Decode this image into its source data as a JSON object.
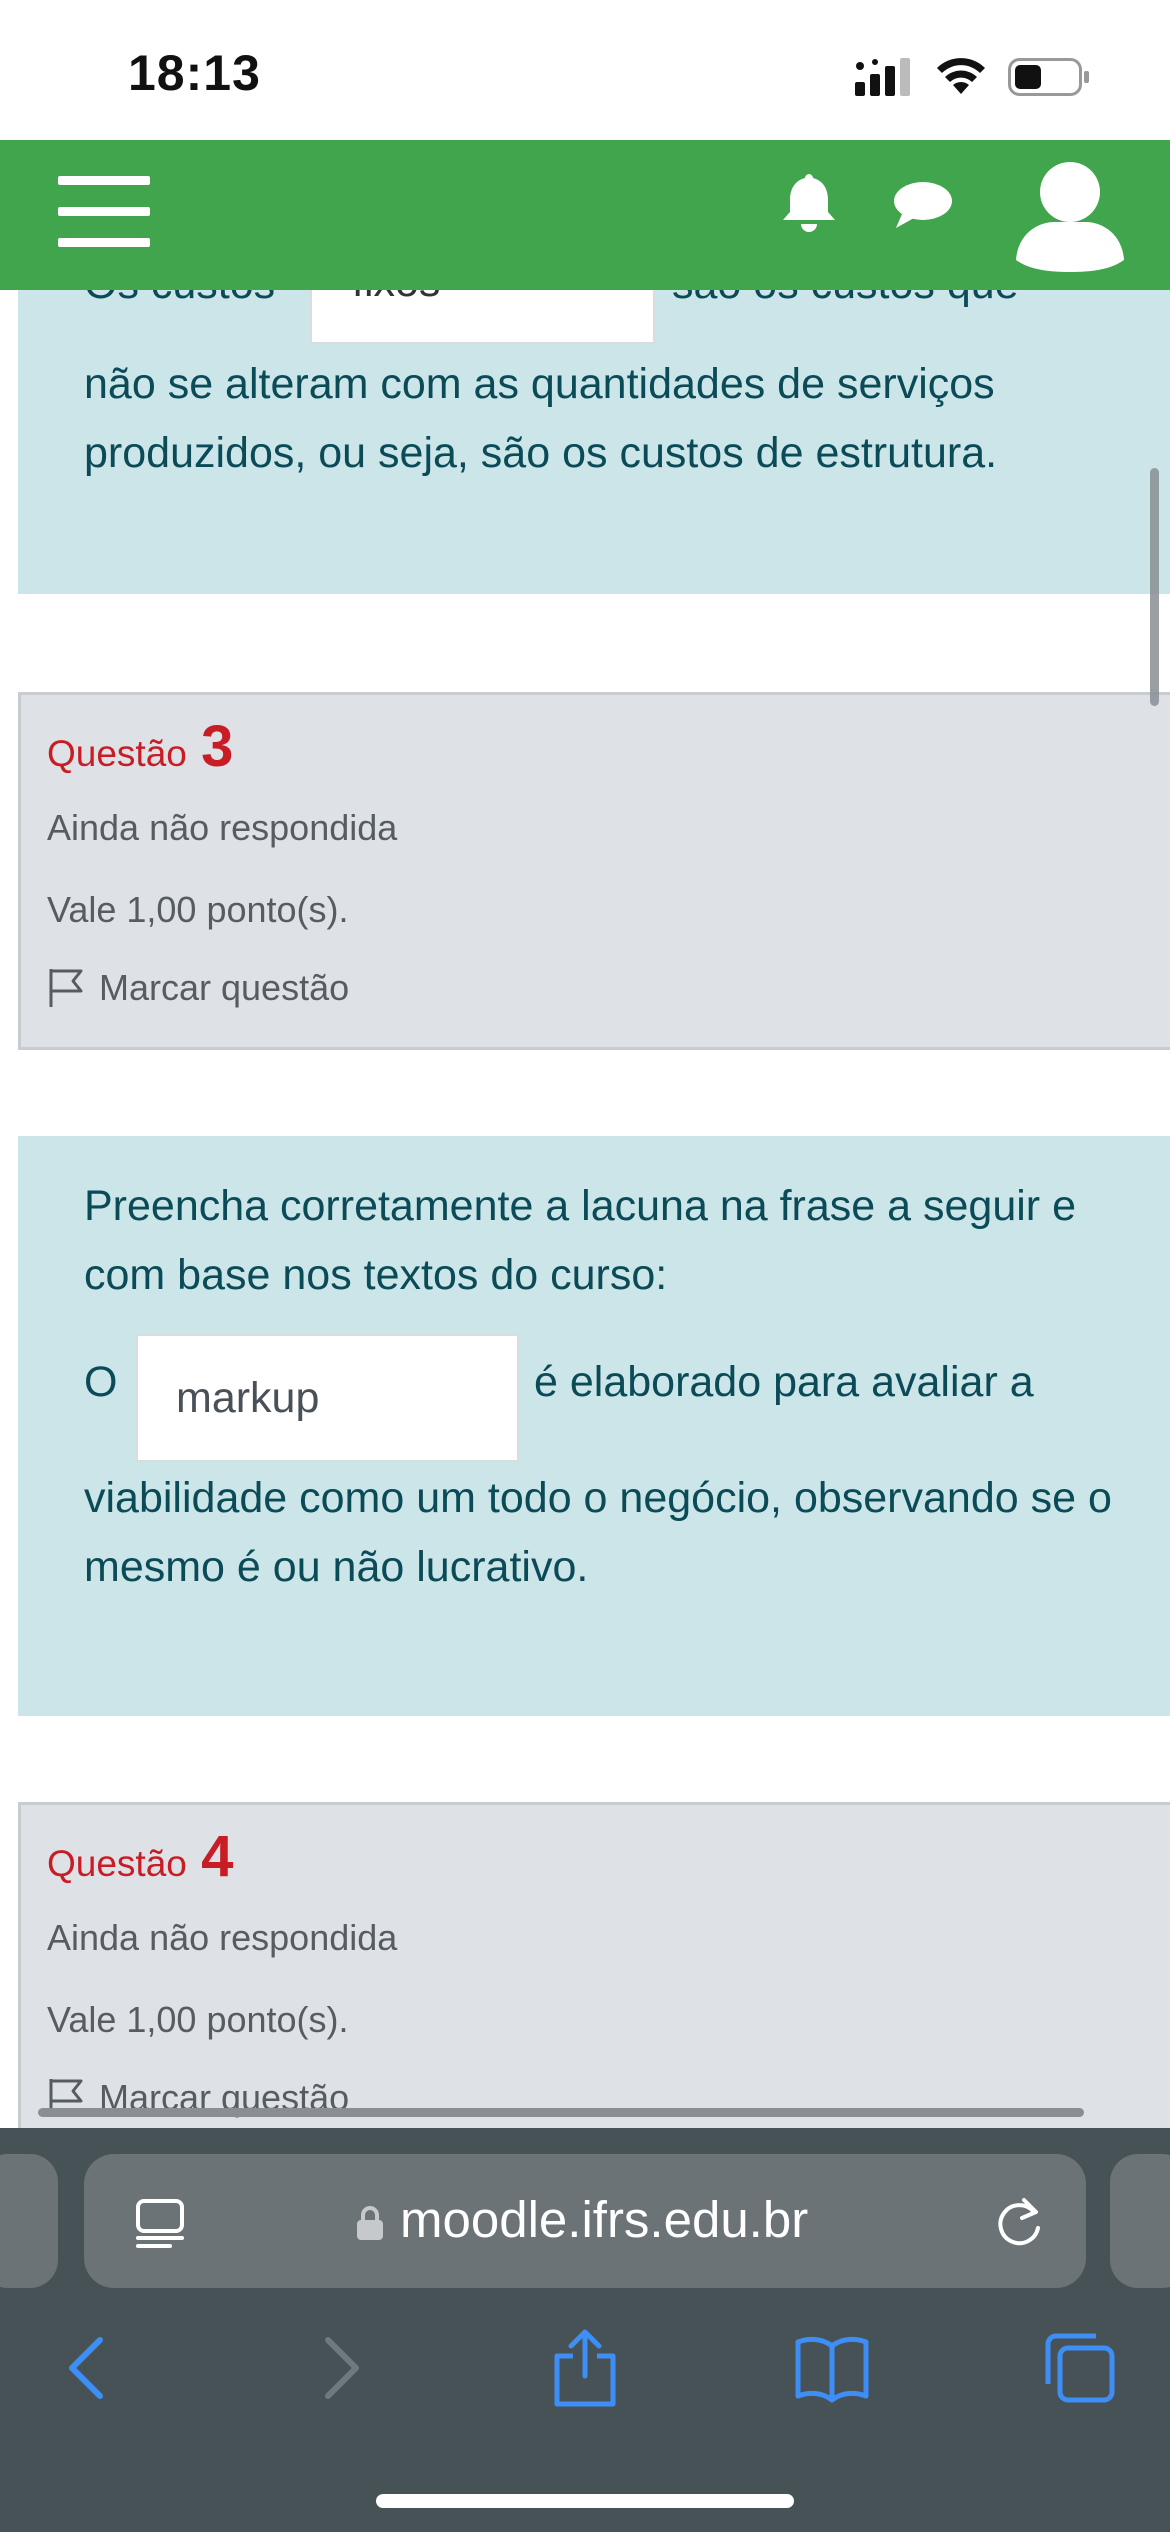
{
  "status_bar": {
    "time": "18:13"
  },
  "header": {
    "menu_icon": "hamburger-icon",
    "notifications_icon": "bell-icon",
    "messages_icon": "chat-icon",
    "user_icon": "user-avatar-icon",
    "bg_color": "#40a54c"
  },
  "question2_text": {
    "partial_top_left": "Os custos",
    "blank_value": "fixos",
    "partial_top_right": "são os custos que",
    "paragraph": "não se alteram com as quantidades de serviços produzidos, ou seja, são os custos de estrutura."
  },
  "question3_info": {
    "label": "Questão",
    "number": "3",
    "state": "Ainda não respondida",
    "grade": "Vale 1,00 ponto(s).",
    "flag_label": "Marcar questão"
  },
  "question3_text": {
    "intro": "Preencha corretamente a lacuna na frase a seguir e com base nos textos do curso:",
    "prefix": "O",
    "blank_value": "markup",
    "suffix": "é elaborado para avaliar a",
    "continuation": "viabilidade como um todo o negócio, observando se o mesmo é ou não lucrativo."
  },
  "question4_info": {
    "label": "Questão",
    "number": "4",
    "state": "Ainda não respondida",
    "grade": "Vale 1,00 ponto(s).",
    "flag_label": "Marcar questão"
  },
  "browser": {
    "url": "moodle.ifrs.edu.br",
    "reader_icon": "reader-mode-icon",
    "lock_icon": "lock-icon",
    "reload_icon": "reload-icon",
    "toolbar": [
      "back-icon",
      "forward-icon",
      "share-icon",
      "bookmarks-icon",
      "tabs-icon"
    ]
  },
  "colors": {
    "question_text_bg": "#cbe5e9",
    "question_info_bg": "#dee2e6",
    "question_number": "#c81d25",
    "question_text": "#0b4b57",
    "safari_bar": "#475257",
    "safari_accent": "#3d8ff5"
  }
}
